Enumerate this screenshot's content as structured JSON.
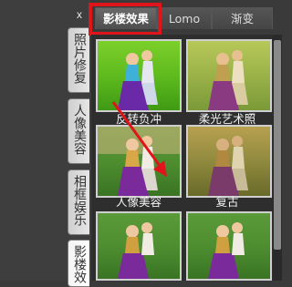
{
  "close_label": "x",
  "top_tabs": [
    {
      "label": "影楼效果",
      "active": true
    },
    {
      "label": "Lomo",
      "active": false
    },
    {
      "label": "渐变",
      "active": false
    }
  ],
  "side_tabs": [
    {
      "label": "照片修复"
    },
    {
      "label": "人像美容"
    },
    {
      "label": "相框娱乐"
    },
    {
      "label": "影楼效"
    }
  ],
  "effects": [
    {
      "label": "反转负冲",
      "style": "inverted"
    },
    {
      "label": "柔光艺术照",
      "style": "softlight"
    },
    {
      "label": "人像美容",
      "style": "normal"
    },
    {
      "label": "复古",
      "style": "retro"
    },
    {
      "label": "",
      "style": "normal"
    },
    {
      "label": "",
      "style": "normal"
    }
  ],
  "colors": {
    "highlight": "#e0141b",
    "arrow": "#e0141b"
  }
}
